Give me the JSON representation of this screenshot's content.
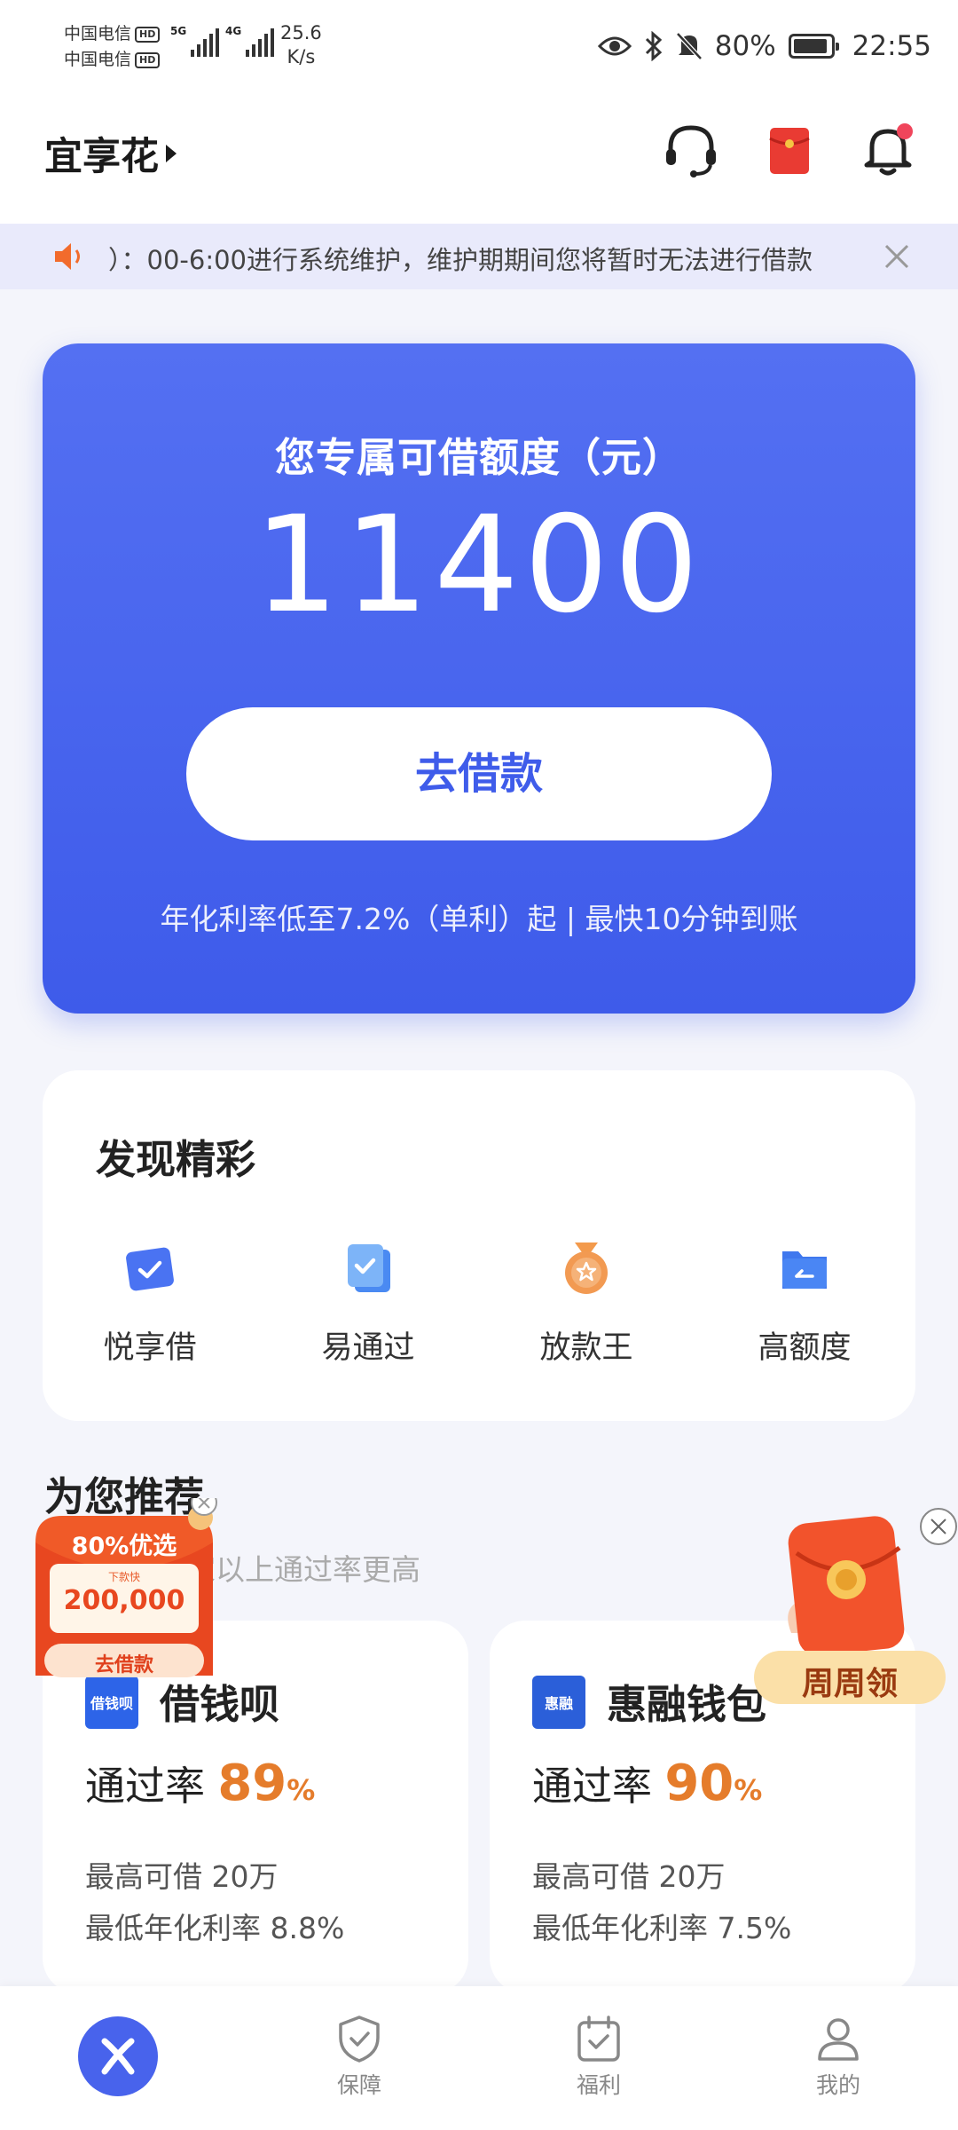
{
  "status_bar": {
    "carrier_1": "中国电信",
    "carrier_2": "中国电信",
    "hd_badge": "HD",
    "net_5g": "5G",
    "net_4g": "4G",
    "speed_value": "25.6",
    "speed_unit": "K/s",
    "battery": "80%",
    "time": "22:55"
  },
  "header": {
    "app_name": "宜享花",
    "icons": [
      "headset-icon",
      "red-envelope-icon",
      "bell-icon"
    ]
  },
  "notice": {
    "text": "）：00-6:00进行系统维护，维护期期间您将暂时无法进行借款"
  },
  "credit": {
    "title": "您专属可借额度（元）",
    "amount": "11400",
    "button": "去借款",
    "note": "年化利率低至7.2%（单利）起 | 最快10分钟到账"
  },
  "discover": {
    "title": "发现精彩",
    "items": [
      {
        "label": "悦享借",
        "icon": "check-card-icon"
      },
      {
        "label": "易通过",
        "icon": "check-doc-icon"
      },
      {
        "label": "放款王",
        "icon": "medal-icon"
      },
      {
        "label": "高额度",
        "icon": "folder-icon"
      }
    ]
  },
  "recommend": {
    "title": "为您推荐",
    "subtitle": "家以上通过率更高",
    "products": [
      {
        "name": "借钱呗",
        "logo_text": "借钱呗",
        "pass_label": "通过率",
        "pass_rate": "89",
        "pass_unit": "%",
        "max_label": "最高可借",
        "max_value": "20万",
        "rate_label": "最低年化利率",
        "rate_value": "8.8",
        "rate_unit": "%"
      },
      {
        "name": "惠融钱包",
        "logo_text": "惠融",
        "pass_label": "通过率",
        "pass_rate": "90",
        "pass_unit": "%",
        "max_label": "最高可借",
        "max_value": "20万",
        "rate_label": "最低年化利率",
        "rate_value": "7.5",
        "rate_unit": "%"
      }
    ]
  },
  "promo_left": {
    "headline": "80%优选",
    "small_tag": "下款快",
    "amount": "200,000",
    "button": "去借款"
  },
  "promo_right": {
    "label": "周周领"
  },
  "bottom_nav": {
    "items": [
      {
        "label": "",
        "icon": "home-x-icon"
      },
      {
        "label": "保障",
        "icon": "shield-icon"
      },
      {
        "label": "福利",
        "icon": "calendar-check-icon"
      },
      {
        "label": "我的",
        "icon": "person-icon"
      }
    ]
  },
  "colors": {
    "brand_blue": "#4863EC",
    "accent_orange": "#E57C2B",
    "notice_bg": "#E9EAFB"
  }
}
